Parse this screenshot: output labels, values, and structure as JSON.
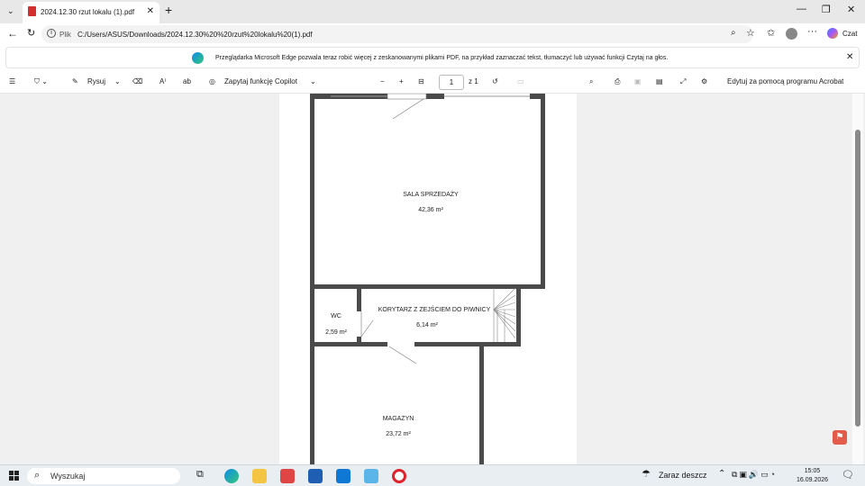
{
  "browser": {
    "tab_title": "2024.12.30 rzut lokalu (1).pdf",
    "new_tab": "+",
    "address_scheme": "Plik",
    "address_url": "C:/Users/ASUS/Downloads/2024.12.30%20%20rzut%20lokalu%20(1).pdf",
    "copilot_label": "Czat",
    "window_min": "—",
    "window_max": "❐",
    "window_close": "✕"
  },
  "infobar": {
    "message": "Przeglądarka Microsoft Edge pozwala teraz robić więcej z zeskanowanymi plikami PDF, na przykład zaznaczać tekst, tłumaczyć lub używać funkcji Czytaj na głos."
  },
  "pdf_toolbar": {
    "draw_label": "Rysuj",
    "copilot_ask": "Zapytaj funkcję Copilot",
    "page_current": "1",
    "page_total": "z 1",
    "edit_acrobat": "Edytuj za pomocą programu Acrobat"
  },
  "floorplan": {
    "rooms": [
      {
        "name": "SALA SPRZEDAŻY",
        "area": "42,36 m²"
      },
      {
        "name": "WC",
        "area": "2,59 m²"
      },
      {
        "name": "KORYTARZ Z ZEJŚCIEM DO PIWNICY",
        "area": "6,14 m²"
      },
      {
        "name": "MAGAZYN",
        "area": "23,72 m²"
      }
    ]
  },
  "taskbar": {
    "search_placeholder": "Wyszukaj",
    "weather": "Zaraz deszcz",
    "time": "15:05",
    "date": "16.09.2026"
  },
  "colors": {
    "wall": "#4a4a4a",
    "taskbar_bg": "#e9eef3",
    "tab_bg": "#e8e8e8"
  }
}
